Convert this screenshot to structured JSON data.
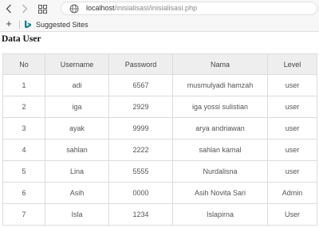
{
  "browser": {
    "url_host": "localhost",
    "url_path": "/inisialisasi/inisialisasi.php",
    "bookmarks": [
      {
        "label": "Suggested Sites",
        "icon": "bing-icon"
      }
    ],
    "colors": {
      "chrome": "#f7f7f7",
      "bing": "#14848f"
    }
  },
  "page": {
    "title": "Data User"
  },
  "table": {
    "columns": [
      "No",
      "Username",
      "Password",
      "Nama",
      "Level"
    ],
    "rows": [
      [
        "1",
        "adi",
        "6567",
        "musmulyadi hamzah",
        "user"
      ],
      [
        "2",
        "iga",
        "2929",
        "iga yossi sulistian",
        "user"
      ],
      [
        "3",
        "ayak",
        "9999",
        "arya andriawan",
        "user"
      ],
      [
        "4",
        "sahlan",
        "2222",
        "sahlan kamal",
        "user"
      ],
      [
        "5",
        "Lina",
        "5555",
        "Nurdalisna",
        "user"
      ],
      [
        "6",
        "Asih",
        "0000",
        "Asih Novita Sari",
        "Admin"
      ],
      [
        "7",
        "Isla",
        "1234",
        "Islapirna",
        "User"
      ]
    ]
  }
}
